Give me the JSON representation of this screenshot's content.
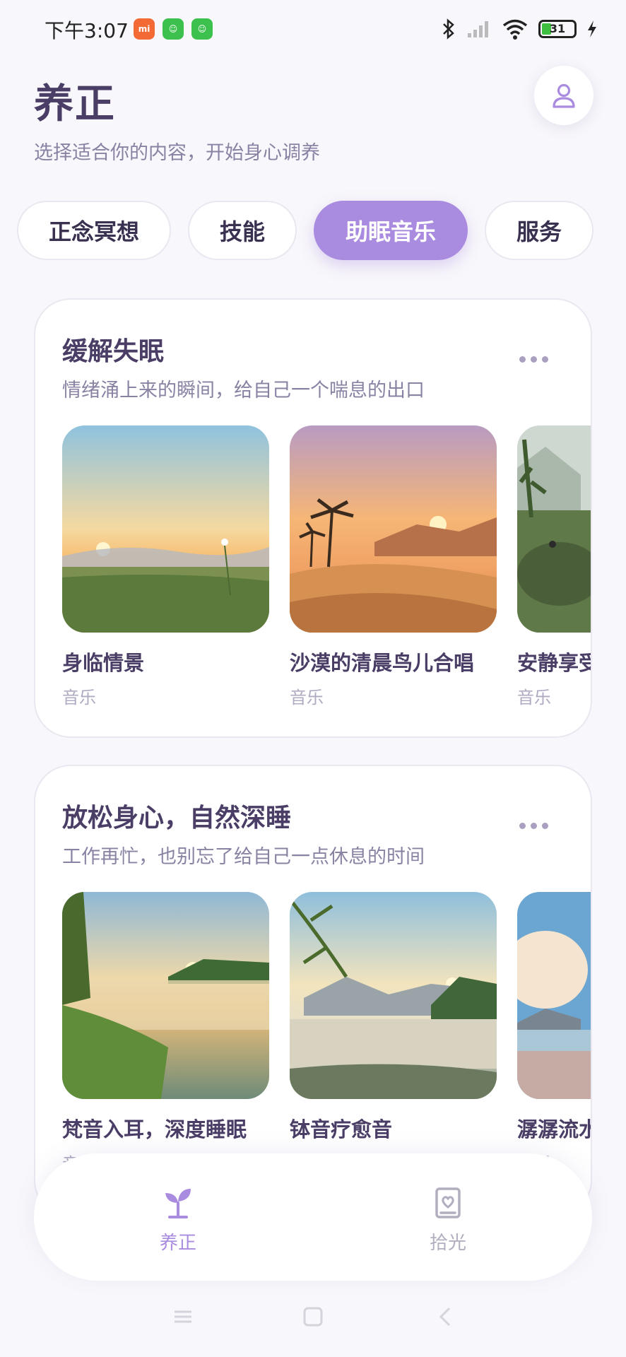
{
  "status_bar": {
    "time": "下午3:07",
    "battery": "31"
  },
  "header": {
    "title": "养正",
    "subtitle": "选择适合你的内容，开始身心调养"
  },
  "tabs": [
    {
      "label": "正念冥想",
      "active": false
    },
    {
      "label": "技能",
      "active": false
    },
    {
      "label": "助眠音乐",
      "active": true
    },
    {
      "label": "服务",
      "active": false
    }
  ],
  "sections": [
    {
      "title": "缓解失眠",
      "description": "情绪涌上来的瞬间，给自己一个喘息的出口",
      "items": [
        {
          "title": "身临情景",
          "type": "音乐"
        },
        {
          "title": "沙漠的清晨鸟儿合唱",
          "type": "音乐"
        },
        {
          "title": "安静享受",
          "type": "音乐"
        }
      ]
    },
    {
      "title": "放松身心，自然深睡",
      "description": "工作再忙，也别忘了给自己一点休息的时间",
      "items": [
        {
          "title": "梵音入耳，深度睡眠",
          "type": "音乐"
        },
        {
          "title": "钵音疗愈音",
          "type": "音乐"
        },
        {
          "title": "潺潺流水",
          "type": "音乐"
        }
      ]
    }
  ],
  "bottom_nav": [
    {
      "label": "养正",
      "icon": "sprout-icon",
      "active": true
    },
    {
      "label": "拾光",
      "icon": "photo-book-icon",
      "active": false
    }
  ],
  "colors": {
    "accent": "#a98be0",
    "title": "#4a3d66",
    "muted": "#8a82a3"
  }
}
